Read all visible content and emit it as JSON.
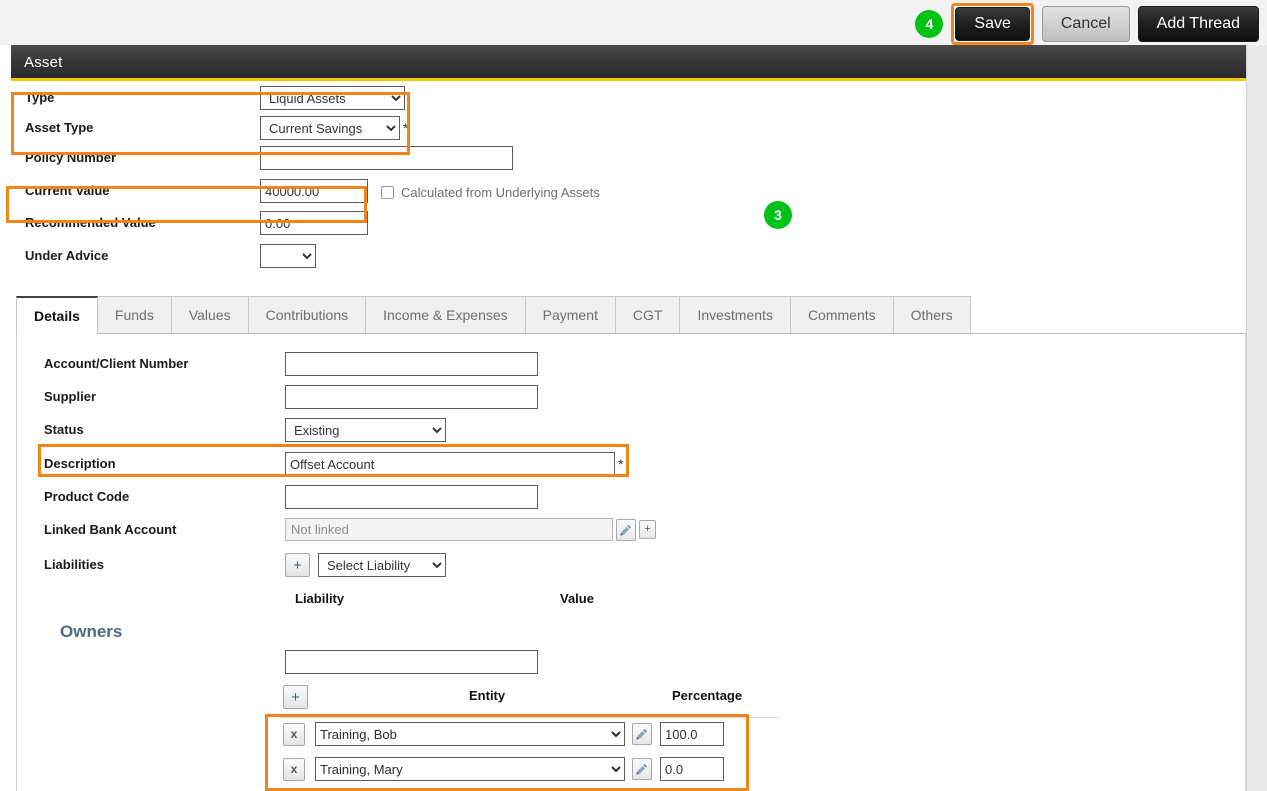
{
  "toolbar": {
    "badge_4": "4",
    "save_label": "Save",
    "cancel_label": "Cancel",
    "add_thread_label": "Add Thread",
    "save_highlight_color": "#f08519",
    "badge_color": "#00c217"
  },
  "panel": {
    "title": "Asset",
    "accent_color": "#f5c400"
  },
  "header_form": {
    "badge_3": "3",
    "fields": [
      {
        "label": "Type",
        "value": "Liquid Assets",
        "kind": "select",
        "required": false
      },
      {
        "label": "Asset Type",
        "value": "Current Savings",
        "kind": "select",
        "required": true
      },
      {
        "label": "Policy Number",
        "value": "",
        "kind": "text",
        "required": false
      },
      {
        "label": "Current Value",
        "value": "40000.00",
        "kind": "text",
        "required": false
      },
      {
        "label": "Recommended Value",
        "value": "0.00",
        "kind": "text",
        "required": false
      },
      {
        "label": "Under Advice",
        "value": "",
        "kind": "select",
        "required": false
      }
    ],
    "checkbox": {
      "label": "Calculated from Underlying Assets",
      "checked": false
    }
  },
  "tabs": [
    {
      "label": "Details",
      "active": true
    },
    {
      "label": "Funds",
      "active": false
    },
    {
      "label": "Values",
      "active": false
    },
    {
      "label": "Contributions",
      "active": false
    },
    {
      "label": "Income & Expenses",
      "active": false
    },
    {
      "label": "Payment",
      "active": false
    },
    {
      "label": "CGT",
      "active": false
    },
    {
      "label": "Investments",
      "active": false
    },
    {
      "label": "Comments",
      "active": false
    },
    {
      "label": "Others",
      "active": false
    }
  ],
  "details": {
    "account_client_number": {
      "label": "Account/Client Number",
      "value": ""
    },
    "supplier": {
      "label": "Supplier",
      "value": ""
    },
    "status": {
      "label": "Status",
      "value": "Existing"
    },
    "description": {
      "label": "Description",
      "value": "Offset Account",
      "required_mark": "*"
    },
    "product_code": {
      "label": "Product Code",
      "value": ""
    },
    "linked_bank_account": {
      "label": "Linked Bank Account",
      "value": "",
      "placeholder": "Not linked",
      "edit_icon": "pencil-icon",
      "add_icon": "plus-icon"
    },
    "liabilities": {
      "label": "Liabilities",
      "add_label": "+",
      "select_value": "Select Liability",
      "columns": [
        "Liability",
        "Value"
      ],
      "rows": []
    }
  },
  "owners": {
    "title": "Owners",
    "search_value": "",
    "add_label": "+",
    "columns": [
      "Entity",
      "Percentage"
    ],
    "rows": [
      {
        "remove_label": "x",
        "entity": "Training, Bob",
        "edit_icon": "pencil-icon",
        "percentage": "100.0"
      },
      {
        "remove_label": "x",
        "entity": "Training, Mary",
        "edit_icon": "pencil-icon",
        "percentage": "0.0"
      }
    ]
  },
  "highlights": {
    "color": "#f08519",
    "regions": [
      "type-asset-type",
      "current-value",
      "description",
      "owner-rows",
      "save-button"
    ]
  }
}
